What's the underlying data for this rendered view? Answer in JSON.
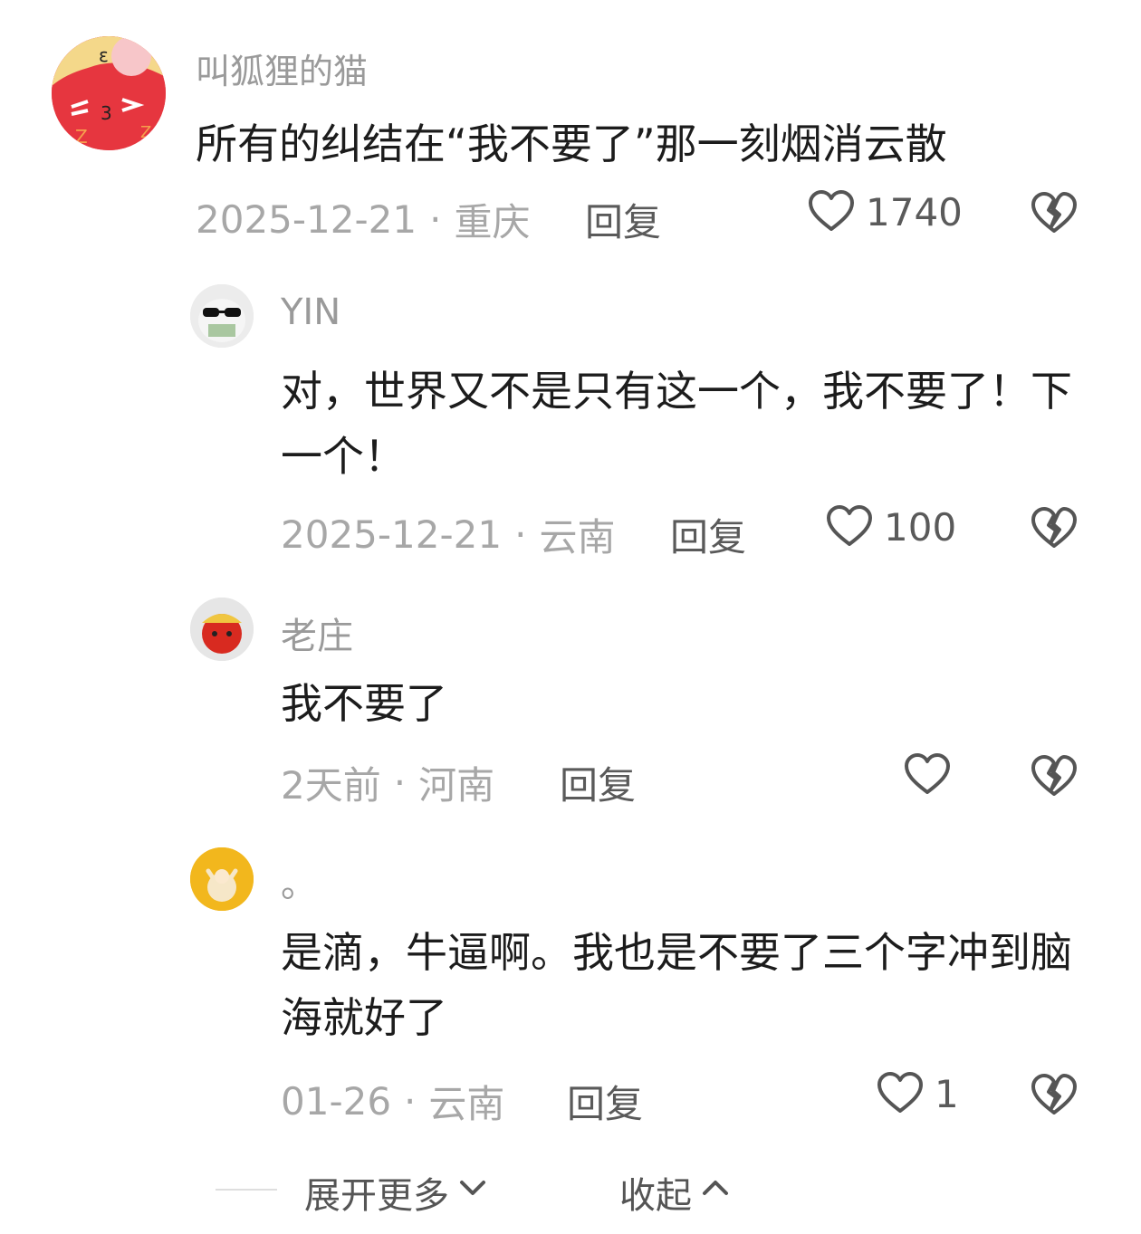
{
  "comments": [
    {
      "username": "叫狐狸的猫",
      "content": "所有的纠结在“我不要了”那一刻烟消云散",
      "date": "2025-12-21",
      "location": "重庆",
      "reply_label": "回复",
      "likes": "1740"
    },
    {
      "username": "YIN",
      "content": "对，世界又不是只有这一个，我不要了！下一个！",
      "date": "2025-12-21",
      "location": "云南",
      "reply_label": "回复",
      "likes": "100"
    },
    {
      "username": "老庄",
      "content": "我不要了",
      "date": "2天前",
      "location": "河南",
      "reply_label": "回复",
      "likes": ""
    },
    {
      "username": "。",
      "content": "是滴，牛逼啊。我也是不要了三个字冲到脑海就好了",
      "date": "01-26",
      "location": "云南",
      "reply_label": "回复",
      "likes": "1"
    }
  ],
  "meta_separator": "·",
  "footer": {
    "expand_label": "展开更多",
    "collapse_label": "收起"
  },
  "icons": {
    "like": "heart-outline-icon",
    "dislike": "broken-heart-icon",
    "expand": "chevron-down-icon",
    "collapse": "chevron-up-icon"
  },
  "colors": {
    "username": "#9a9a9a",
    "meta": "#a7a7a7",
    "text": "#1c1c1c"
  }
}
